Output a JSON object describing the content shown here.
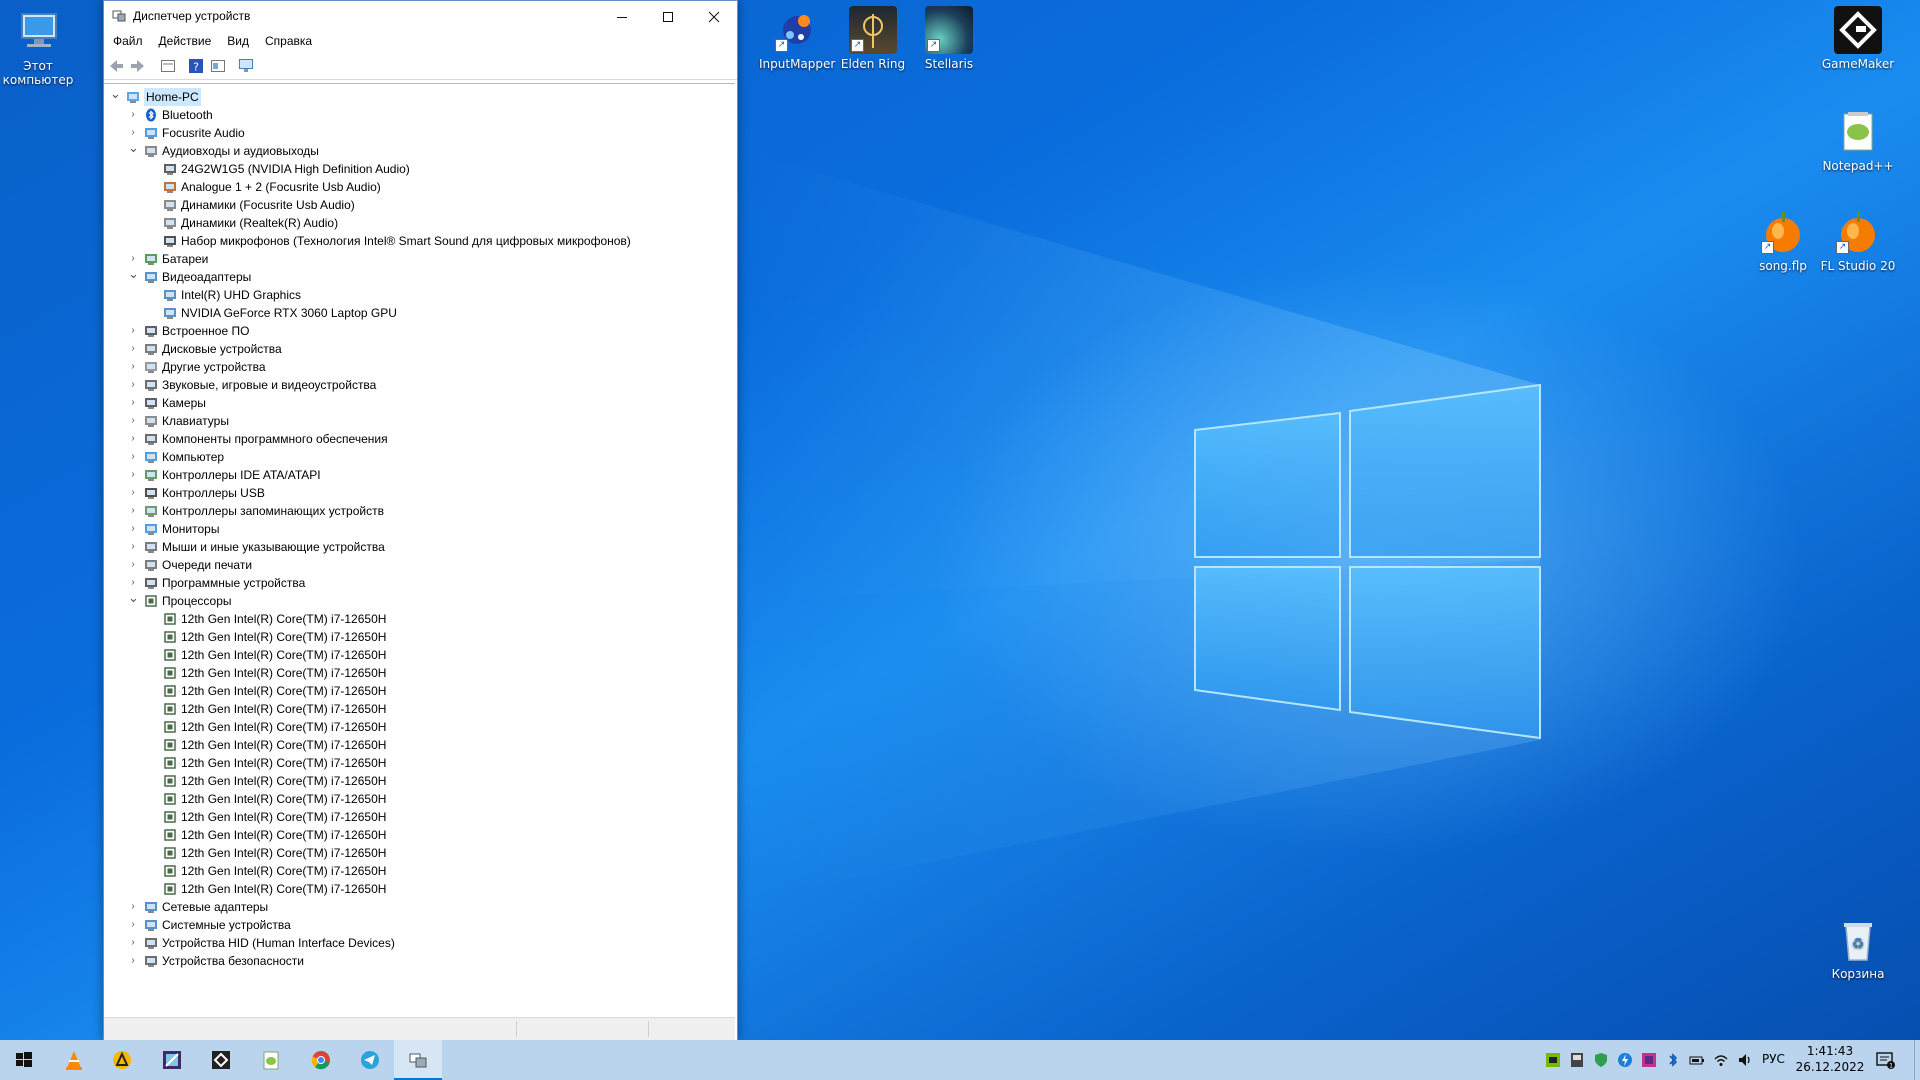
{
  "desktop": {
    "icons": [
      {
        "label": "Этот компьютер",
        "icon": "computer-icon"
      },
      {
        "label": "InputMapper",
        "icon": "inputmapper-icon"
      },
      {
        "label": "Elden Ring",
        "icon": "elden-ring-icon"
      },
      {
        "label": "Stellaris",
        "icon": "stellaris-icon"
      },
      {
        "label": "GameMaker",
        "icon": "gamemaker-icon"
      },
      {
        "label": "Notepad++",
        "icon": "notepadpp-icon"
      },
      {
        "label": "song.flp",
        "icon": "fl-file-icon"
      },
      {
        "label": "FL Studio 20",
        "icon": "fl-studio-icon"
      },
      {
        "label": "Корзина",
        "icon": "recycle-bin-icon"
      }
    ]
  },
  "window": {
    "title": "Диспетчер устройств",
    "menu": [
      "Файл",
      "Действие",
      "Вид",
      "Справка"
    ],
    "tree": [
      {
        "label": "Home-PC",
        "level": 0,
        "expanded": true,
        "icon": "computer-icon"
      },
      {
        "label": "Bluetooth",
        "level": 1,
        "expanded": false,
        "icon": "bluetooth-icon"
      },
      {
        "label": "Focusrite Audio",
        "level": 1,
        "expanded": false,
        "icon": "monitor-icon"
      },
      {
        "label": "Аудиовходы и аудиовыходы",
        "level": 1,
        "expanded": true,
        "icon": "speaker-icon"
      },
      {
        "label": "24G2W1G5 (NVIDIA High Definition Audio)",
        "level": 2,
        "icon": "monitor-small-icon"
      },
      {
        "label": "Analogue 1 + 2 (Focusrite Usb Audio)",
        "level": 2,
        "icon": "line-in-icon"
      },
      {
        "label": "Динамики (Focusrite Usb Audio)",
        "level": 2,
        "icon": "speaker-icon"
      },
      {
        "label": "Динамики (Realtek(R) Audio)",
        "level": 2,
        "icon": "speaker-icon"
      },
      {
        "label": "Набор микрофонов (Технология Intel® Smart Sound для цифровых микрофонов)",
        "level": 2,
        "icon": "microphone-icon"
      },
      {
        "label": "Батареи",
        "level": 1,
        "expanded": false,
        "icon": "battery-icon"
      },
      {
        "label": "Видеоадаптеры",
        "level": 1,
        "expanded": true,
        "icon": "display-adapter-icon"
      },
      {
        "label": "Intel(R) UHD Graphics",
        "level": 2,
        "icon": "display-adapter-icon"
      },
      {
        "label": "NVIDIA GeForce RTX 3060 Laptop GPU",
        "level": 2,
        "icon": "display-adapter-icon"
      },
      {
        "label": "Встроенное ПО",
        "level": 1,
        "expanded": false,
        "icon": "firmware-icon"
      },
      {
        "label": "Дисковые устройства",
        "level": 1,
        "expanded": false,
        "icon": "disk-icon"
      },
      {
        "label": "Другие устройства",
        "level": 1,
        "expanded": false,
        "icon": "unknown-device-icon"
      },
      {
        "label": "Звуковые, игровые и видеоустройства",
        "level": 1,
        "expanded": false,
        "icon": "sound-icon"
      },
      {
        "label": "Камеры",
        "level": 1,
        "expanded": false,
        "icon": "camera-icon"
      },
      {
        "label": "Клавиатуры",
        "level": 1,
        "expanded": false,
        "icon": "keyboard-icon"
      },
      {
        "label": "Компоненты программного обеспечения",
        "level": 1,
        "expanded": false,
        "icon": "software-component-icon"
      },
      {
        "label": "Компьютер",
        "level": 1,
        "expanded": false,
        "icon": "monitor-icon"
      },
      {
        "label": "Контроллеры IDE ATA/ATAPI",
        "level": 1,
        "expanded": false,
        "icon": "ide-controller-icon"
      },
      {
        "label": "Контроллеры USB",
        "level": 1,
        "expanded": false,
        "icon": "usb-icon"
      },
      {
        "label": "Контроллеры запоминающих устройств",
        "level": 1,
        "expanded": false,
        "icon": "storage-controller-icon"
      },
      {
        "label": "Мониторы",
        "level": 1,
        "expanded": false,
        "icon": "monitor-icon"
      },
      {
        "label": "Мыши и иные указывающие устройства",
        "level": 1,
        "expanded": false,
        "icon": "mouse-icon"
      },
      {
        "label": "Очереди печати",
        "level": 1,
        "expanded": false,
        "icon": "printer-icon"
      },
      {
        "label": "Программные устройства",
        "level": 1,
        "expanded": false,
        "icon": "software-device-icon"
      },
      {
        "label": "Процессоры",
        "level": 1,
        "expanded": true,
        "icon": "cpu-icon"
      },
      {
        "label": "12th Gen Intel(R) Core(TM) i7-12650H",
        "level": 2,
        "icon": "cpu-icon"
      },
      {
        "label": "12th Gen Intel(R) Core(TM) i7-12650H",
        "level": 2,
        "icon": "cpu-icon"
      },
      {
        "label": "12th Gen Intel(R) Core(TM) i7-12650H",
        "level": 2,
        "icon": "cpu-icon"
      },
      {
        "label": "12th Gen Intel(R) Core(TM) i7-12650H",
        "level": 2,
        "icon": "cpu-icon"
      },
      {
        "label": "12th Gen Intel(R) Core(TM) i7-12650H",
        "level": 2,
        "icon": "cpu-icon"
      },
      {
        "label": "12th Gen Intel(R) Core(TM) i7-12650H",
        "level": 2,
        "icon": "cpu-icon"
      },
      {
        "label": "12th Gen Intel(R) Core(TM) i7-12650H",
        "level": 2,
        "icon": "cpu-icon"
      },
      {
        "label": "12th Gen Intel(R) Core(TM) i7-12650H",
        "level": 2,
        "icon": "cpu-icon"
      },
      {
        "label": "12th Gen Intel(R) Core(TM) i7-12650H",
        "level": 2,
        "icon": "cpu-icon"
      },
      {
        "label": "12th Gen Intel(R) Core(TM) i7-12650H",
        "level": 2,
        "icon": "cpu-icon"
      },
      {
        "label": "12th Gen Intel(R) Core(TM) i7-12650H",
        "level": 2,
        "icon": "cpu-icon"
      },
      {
        "label": "12th Gen Intel(R) Core(TM) i7-12650H",
        "level": 2,
        "icon": "cpu-icon"
      },
      {
        "label": "12th Gen Intel(R) Core(TM) i7-12650H",
        "level": 2,
        "icon": "cpu-icon"
      },
      {
        "label": "12th Gen Intel(R) Core(TM) i7-12650H",
        "level": 2,
        "icon": "cpu-icon"
      },
      {
        "label": "12th Gen Intel(R) Core(TM) i7-12650H",
        "level": 2,
        "icon": "cpu-icon"
      },
      {
        "label": "12th Gen Intel(R) Core(TM) i7-12650H",
        "level": 2,
        "icon": "cpu-icon"
      },
      {
        "label": "Сетевые адаптеры",
        "level": 1,
        "expanded": false,
        "icon": "network-adapter-icon"
      },
      {
        "label": "Системные устройства",
        "level": 1,
        "expanded": false,
        "icon": "system-device-icon"
      },
      {
        "label": "Устройства HID (Human Interface Devices)",
        "level": 1,
        "expanded": false,
        "icon": "hid-icon"
      },
      {
        "label": "Устройства безопасности",
        "level": 1,
        "expanded": false,
        "icon": "security-device-icon"
      }
    ]
  },
  "taskbar": {
    "apps": [
      "start-icon",
      "vlc-icon",
      "aimp-icon",
      "photo-editor-icon",
      "unity-icon",
      "notepadpp-icon",
      "chrome-icon",
      "telegram-icon",
      "device-manager-icon"
    ],
    "tray": [
      "nvidia-icon",
      "tray-app-icon",
      "security-shield-icon",
      "lightning-icon",
      "tray-app2-icon",
      "bluetooth-icon",
      "battery-icon",
      "wifi-icon",
      "volume-icon"
    ],
    "language": "РУС",
    "time": "1:41:43",
    "date": "26.12.2022"
  },
  "colors": {
    "accent": "#0078d7",
    "taskbar": "#b9d4ec",
    "wallpaper": "#0a6ddc"
  }
}
